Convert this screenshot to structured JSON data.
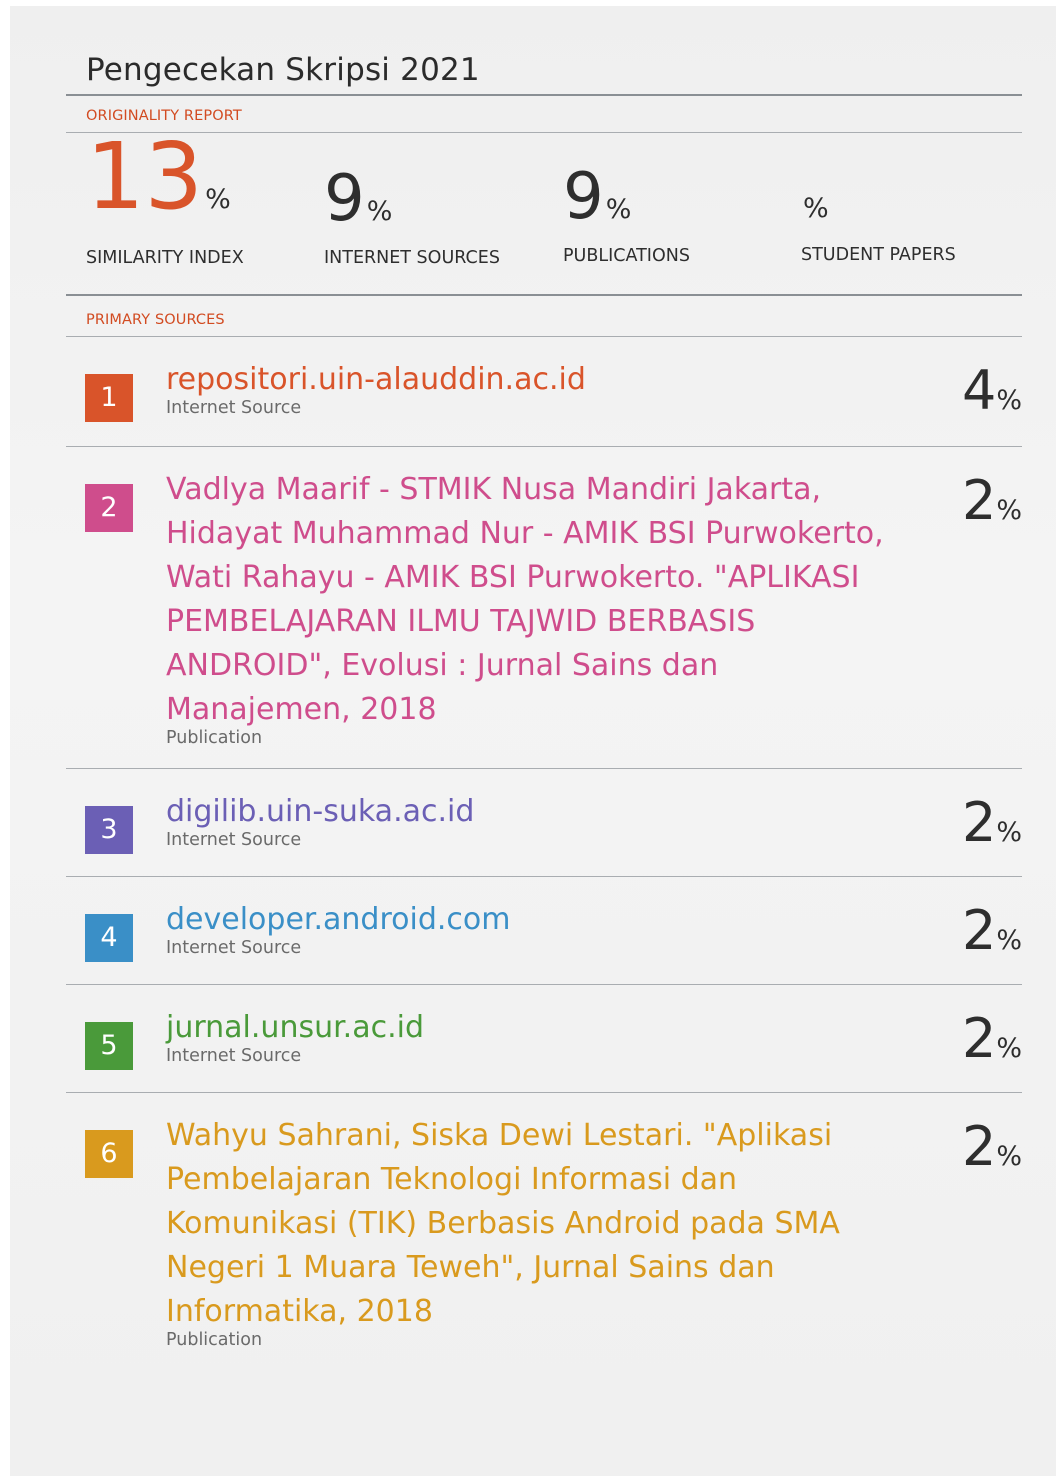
{
  "document": {
    "title": "Pengecekan Skripsi 2021",
    "report_label": "ORIGINALITY REPORT",
    "sources_label": "PRIMARY SOURCES"
  },
  "stats": [
    {
      "value": "13",
      "unit": "%",
      "label": "SIMILARITY INDEX"
    },
    {
      "value": "9",
      "unit": "%",
      "label": "INTERNET SOURCES"
    },
    {
      "value": "9",
      "unit": "%",
      "label": "PUBLICATIONS"
    },
    {
      "value": "",
      "unit": "%",
      "label": "STUDENT PAPERS"
    }
  ],
  "sources": [
    {
      "rank": "1",
      "title": "repositori.uin-alauddin.ac.id",
      "type": "Internet Source",
      "share": "4",
      "unit": "%",
      "color": "#d9542a"
    },
    {
      "rank": "2",
      "title": "Vadlya Maarif - STMIK Nusa Mandiri Jakarta, Hidayat Muhammad Nur - AMIK BSI Purwokerto, Wati Rahayu - AMIK BSI Purwokerto. \"APLIKASI PEMBELAJARAN ILMU TAJWID BERBASIS ANDROID\", Evolusi : Jurnal Sains dan Manajemen, 2018",
      "type": "Publication",
      "share": "2",
      "unit": "%",
      "color": "#cf4d8c"
    },
    {
      "rank": "3",
      "title": "digilib.uin-suka.ac.id",
      "type": "Internet Source",
      "share": "2",
      "unit": "%",
      "color": "#6b5fb5"
    },
    {
      "rank": "4",
      "title": "developer.android.com",
      "type": "Internet Source",
      "share": "2",
      "unit": "%",
      "color": "#3a8fc7"
    },
    {
      "rank": "5",
      "title": "jurnal.unsur.ac.id",
      "type": "Internet Source",
      "share": "2",
      "unit": "%",
      "color": "#4a9a3a"
    },
    {
      "rank": "6",
      "title": "Wahyu Sahrani, Siska Dewi Lestari. \"Aplikasi Pembelajaran Teknologi Informasi dan Komunikasi (TIK) Berbasis Android pada SMA Negeri 1 Muara Teweh\", Jurnal Sains dan Informatika, 2018",
      "type": "Publication",
      "share": "2",
      "unit": "%",
      "color": "#d99a1e"
    }
  ]
}
